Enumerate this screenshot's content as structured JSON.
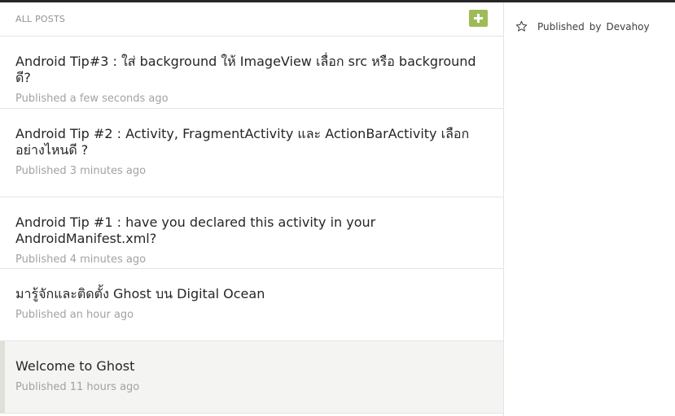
{
  "list": {
    "header_title": "ALL POSTS",
    "add_icon": "plus-icon"
  },
  "posts": [
    {
      "title": "Android Tip#3 : ใส่ background ให้ ImageView เลื่อก src หรือ background ดี?",
      "meta": "Published a few seconds ago",
      "active": false
    },
    {
      "title": "Android Tip #2 : Activity, FragmentActivity และ ActionBarActivity เลือกอย่างไหนดี ?",
      "meta": "Published 3 minutes ago",
      "active": false
    },
    {
      "title": "Android Tip #1 : have you declared this activity in your AndroidManifest.xml?",
      "meta": "Published 4 minutes ago",
      "active": false
    },
    {
      "title": "มารู้จักและติดตั้ง Ghost บน Digital Ocean",
      "meta": "Published an hour ago",
      "active": false
    },
    {
      "title": "Welcome to Ghost",
      "meta": "Published 11 hours ago",
      "active": true
    }
  ],
  "detail": {
    "star_icon": "star-icon",
    "published_label": "Published",
    "by_label": "by",
    "author": "Devahoy"
  },
  "colors": {
    "accent": "#9fbb58",
    "topbar": "#242628",
    "active_row": "#f4f4f2"
  }
}
